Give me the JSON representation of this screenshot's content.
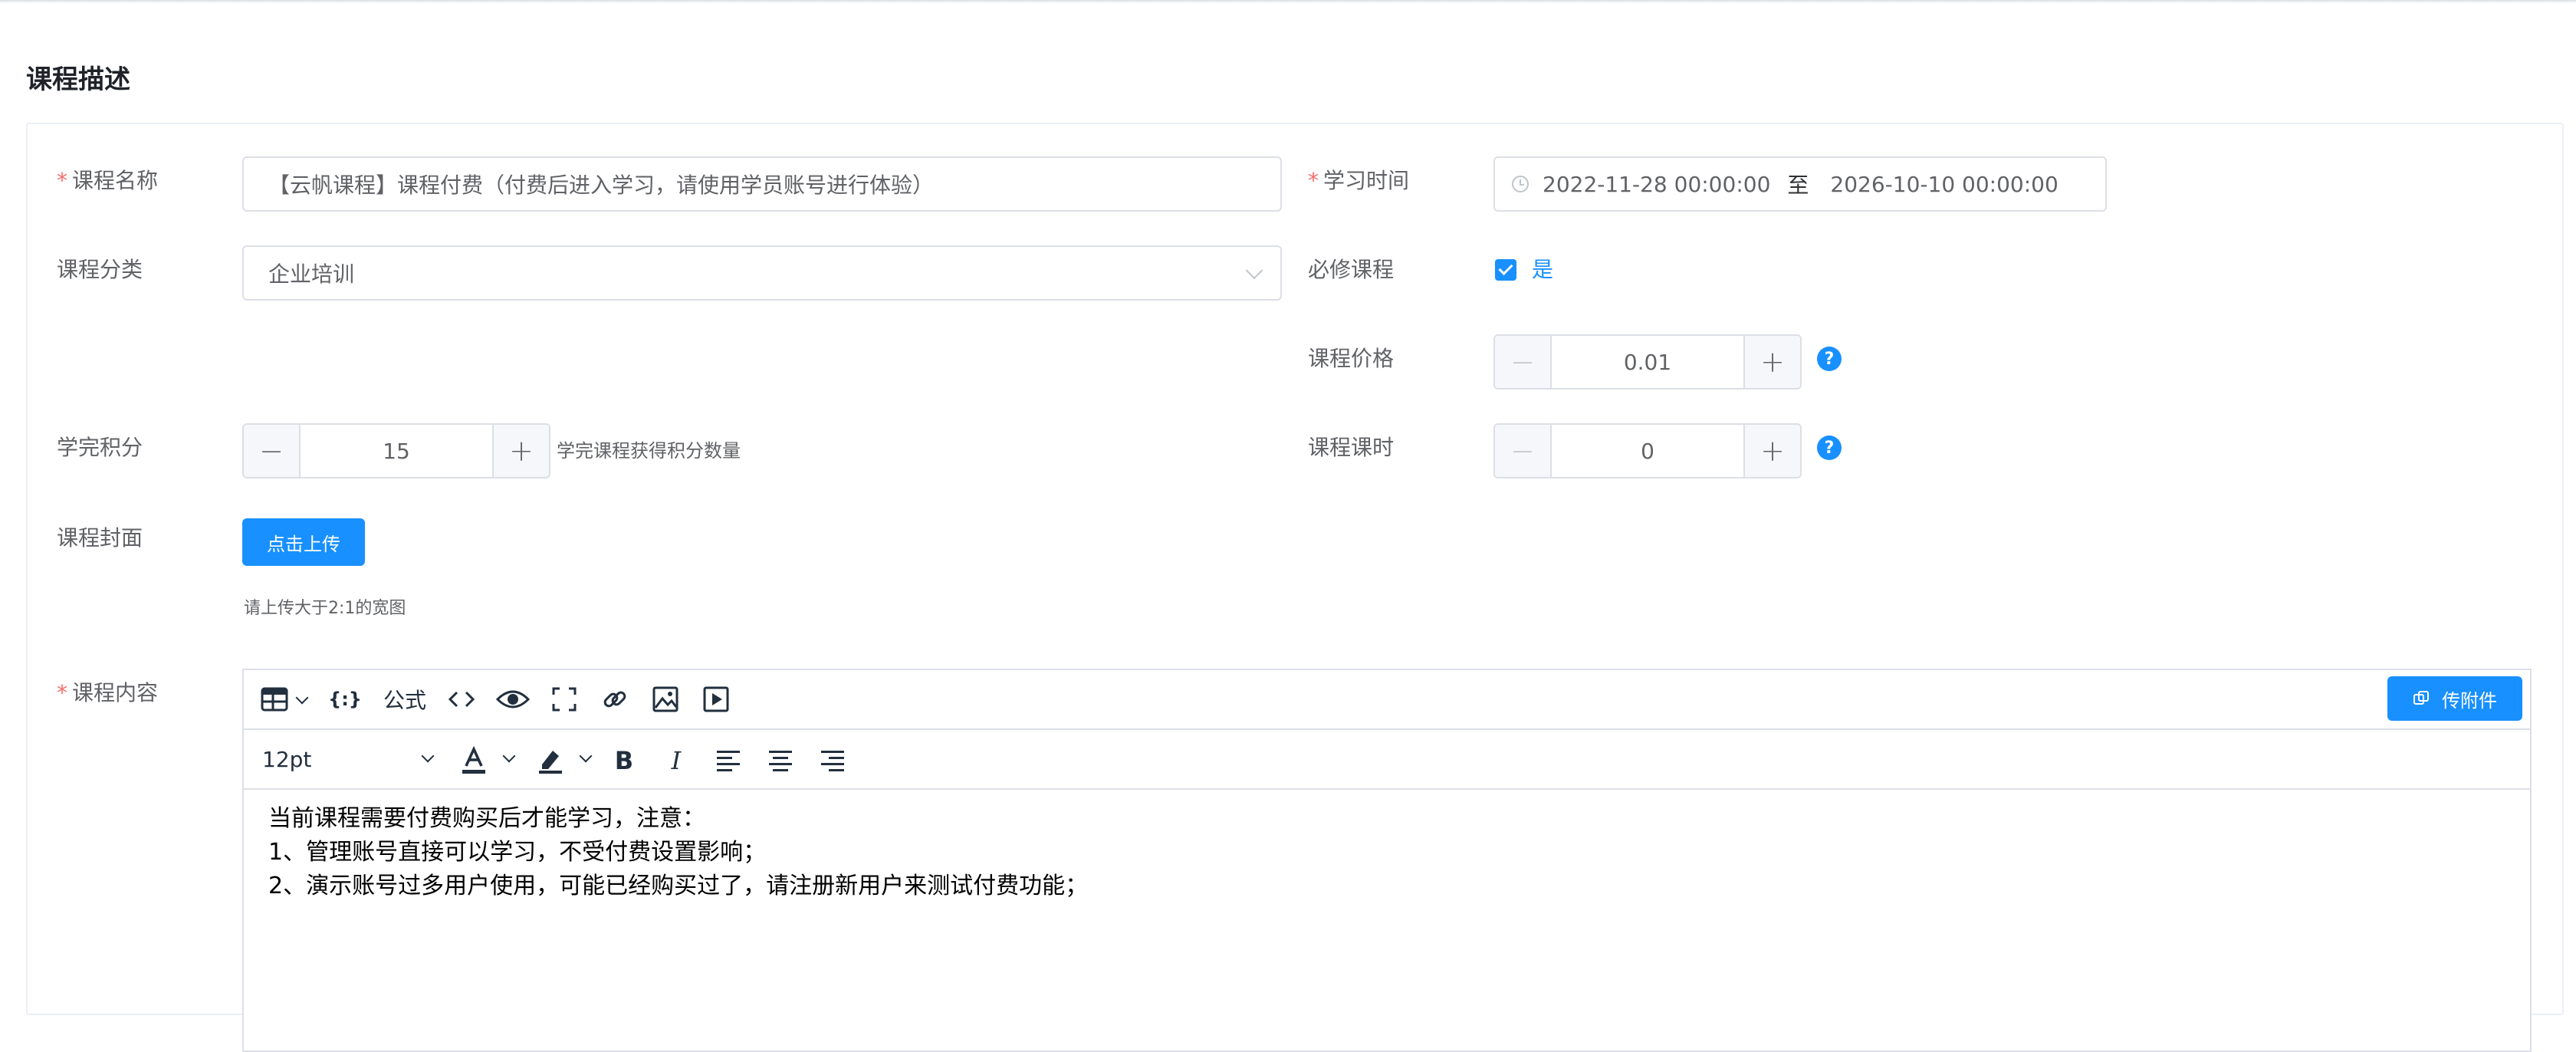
{
  "section": {
    "title": "课程描述"
  },
  "form": {
    "course_name": {
      "label": "课程名称",
      "required_mark": "*",
      "value": "【云帆课程】课程付费（付费后进入学习，请使用学员账号进行体验）"
    },
    "study_time": {
      "label": "学习时间",
      "required_mark": "*",
      "start": "2022-11-28 00:00:00",
      "separator": "至",
      "end": "2026-10-10 00:00:00"
    },
    "course_category": {
      "label": "课程分类",
      "value": "企业培训"
    },
    "required_course": {
      "label": "必修课程",
      "checked": true,
      "option_label": "是"
    },
    "course_price": {
      "label": "课程价格",
      "value": "0.01"
    },
    "completion_points": {
      "label": "学完积分",
      "value": "15",
      "suffix": "学完课程获得积分数量"
    },
    "course_hours": {
      "label": "课程课时",
      "value": "0"
    },
    "cover": {
      "label": "课程封面",
      "upload_button": "点击上传",
      "hint": "请上传大于2:1的宽图"
    },
    "content": {
      "label": "课程内容",
      "required_mark": "*"
    }
  },
  "editor": {
    "toolbar_row1": {
      "items": [
        "table-icon",
        "code-sample-icon",
        "formula",
        "source-code-icon",
        "preview-icon",
        "fullscreen-icon",
        "link-icon",
        "image-icon",
        "media-icon"
      ],
      "formula_label": "公式",
      "attach_button": "传附件"
    },
    "toolbar_row2": {
      "font_size": "12pt",
      "items": [
        "text-color-icon",
        "highlight-icon",
        "bold-icon",
        "italic-icon",
        "align-left-icon",
        "align-center-icon",
        "align-right-icon"
      ]
    },
    "body_lines": [
      "当前课程需要付费购买后才能学习，注意：",
      "1、管理账号直接可以学习，不受付费设置影响；",
      "2、演示账号过多用户使用，可能已经购买过了，请注册新用户来测试付费功能；"
    ]
  },
  "colors": {
    "primary": "#1890ff",
    "required": "#f56c6c",
    "border": "#dcdfe6"
  },
  "stepper_symbols": {
    "minus": "−",
    "plus": "+"
  },
  "help_symbol": "?"
}
